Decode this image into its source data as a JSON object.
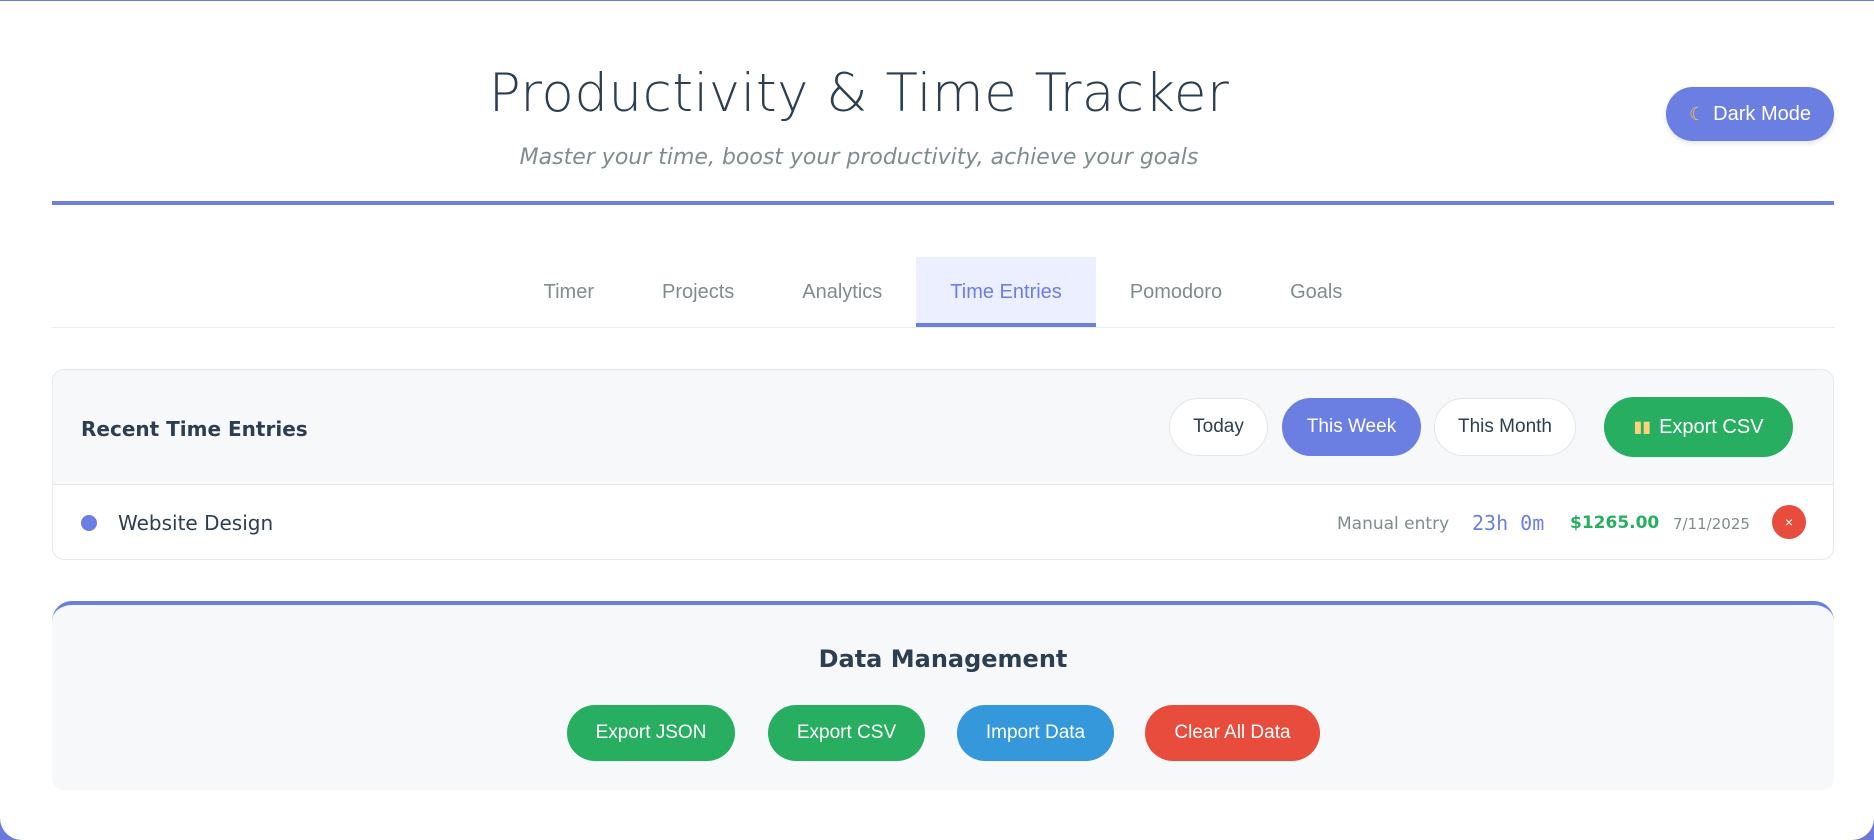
{
  "header": {
    "title": "Productivity & Time Tracker",
    "subtitle": "Master your time, boost your productivity, achieve your goals",
    "dark_mode_label": "Dark Mode",
    "dark_mode_icon": "moon-icon"
  },
  "tabs": [
    {
      "label": "Timer"
    },
    {
      "label": "Projects"
    },
    {
      "label": "Analytics"
    },
    {
      "label": "Time Entries",
      "active": true
    },
    {
      "label": "Pomodoro"
    },
    {
      "label": "Goals"
    }
  ],
  "entries": {
    "title": "Recent Time Entries",
    "filters": {
      "today": "Today",
      "this_week": "This Week",
      "this_month": "This Month",
      "selected": "This Week"
    },
    "export_csv_label": "Export CSV",
    "export_icon": "bar-chart-icon",
    "rows": [
      {
        "project": "Website Design",
        "project_color": "#6b7ee2",
        "description": "Manual entry",
        "duration": "23h 0m",
        "amount": "$1265.00",
        "date": "7/11/2025",
        "delete_label": "×"
      }
    ]
  },
  "data_management": {
    "title": "Data Management",
    "export_json": "Export JSON",
    "export_csv": "Export CSV",
    "import_data": "Import Data",
    "clear_all": "Clear All Data"
  },
  "colors": {
    "accent": "#6b7ee2",
    "success": "#27ae60",
    "info": "#3498db",
    "danger": "#e74c3c"
  }
}
